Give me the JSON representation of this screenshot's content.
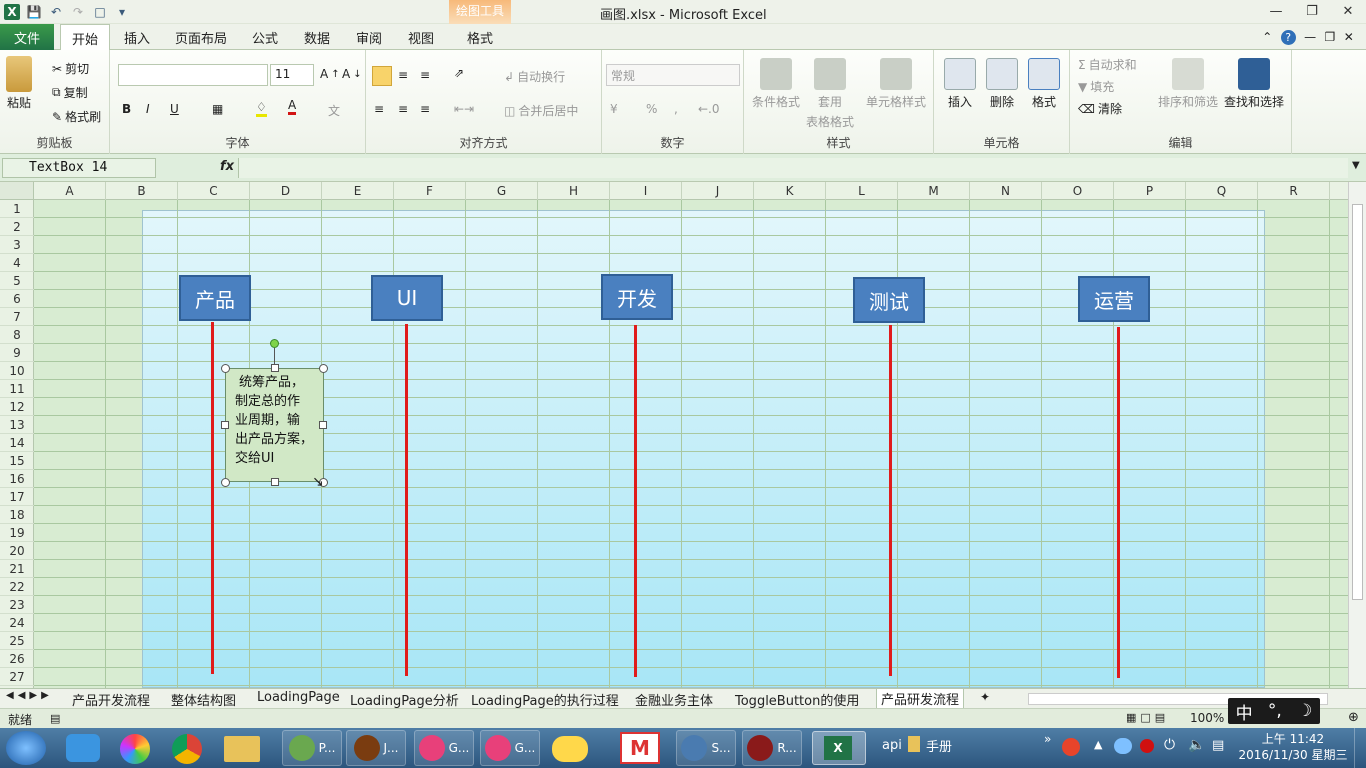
{
  "window": {
    "title": "画图.xlsx - Microsoft Excel",
    "contextual_group": "绘图工具"
  },
  "tabs": [
    "文件",
    "开始",
    "插入",
    "页面布局",
    "公式",
    "数据",
    "审阅",
    "视图",
    "格式"
  ],
  "ribbon": {
    "clipboard": {
      "paste": "粘贴",
      "cut": "剪切",
      "copy": "复制",
      "format_painter": "格式刷",
      "label": "剪贴板"
    },
    "font": {
      "size": "11",
      "bold": "B",
      "italic": "I",
      "underline": "U",
      "font_color": "A",
      "label": "字体"
    },
    "alignment": {
      "wrap": "自动换行",
      "merge": "合并后居中",
      "label": "对齐方式"
    },
    "number": {
      "format": "常规",
      "percent": "%",
      "comma": ",",
      "label": "数字"
    },
    "styles": {
      "conditional": "条件格式",
      "table1": "套用",
      "table2": "表格格式",
      "cell_styles": "单元格样式",
      "label": "样式"
    },
    "cells": {
      "insert": "插入",
      "delete": "删除",
      "format": "格式",
      "label": "单元格"
    },
    "editing": {
      "autosum": "自动求和",
      "fill": "填充",
      "clear": "清除",
      "sort": "排序和筛选",
      "find": "查找和选择",
      "label": "编辑"
    }
  },
  "formula_bar": {
    "name_box": "TextBox 14",
    "fx": "fx",
    "value": ""
  },
  "columns": [
    "A",
    "B",
    "C",
    "D",
    "E",
    "F",
    "G",
    "H",
    "I",
    "J",
    "K",
    "L",
    "M",
    "N",
    "O",
    "P",
    "Q",
    "R"
  ],
  "rows": [
    "1",
    "2",
    "3",
    "4",
    "5",
    "6",
    "7",
    "8",
    "9",
    "10",
    "11",
    "12",
    "13",
    "14",
    "15",
    "16",
    "17",
    "18",
    "19",
    "20",
    "21",
    "22",
    "23",
    "24",
    "25",
    "26",
    "27"
  ],
  "diagram": {
    "lanes": [
      "产品",
      "UI",
      "开发",
      "测试",
      "运营"
    ],
    "textbox_lines": [
      "统筹产品，",
      "制定总的作",
      "业周期，输",
      "出产品方案，",
      "交给UI"
    ],
    "lane_color": "#4a80c0",
    "line_color": "#e01b1b"
  },
  "sheet_tabs": [
    "产品开发流程",
    "整体结构图",
    "LoadingPage",
    "LoadingPage分析",
    "LoadingPage的执行过程",
    "金融业务主体",
    "ToggleButton的使用",
    "产品研发流程"
  ],
  "status": {
    "ready": "就绪",
    "zoom": "100%"
  },
  "ime": {
    "lang": "中",
    "punct": "°,",
    "moon": "☽"
  },
  "taskbar": {
    "apps": [
      "P...",
      "J...",
      "G...",
      "G...",
      "S...",
      "R..."
    ],
    "tray_text": "api",
    "folder": "手册",
    "time": "上午 11:42",
    "date": "2016/11/30 星期三"
  }
}
